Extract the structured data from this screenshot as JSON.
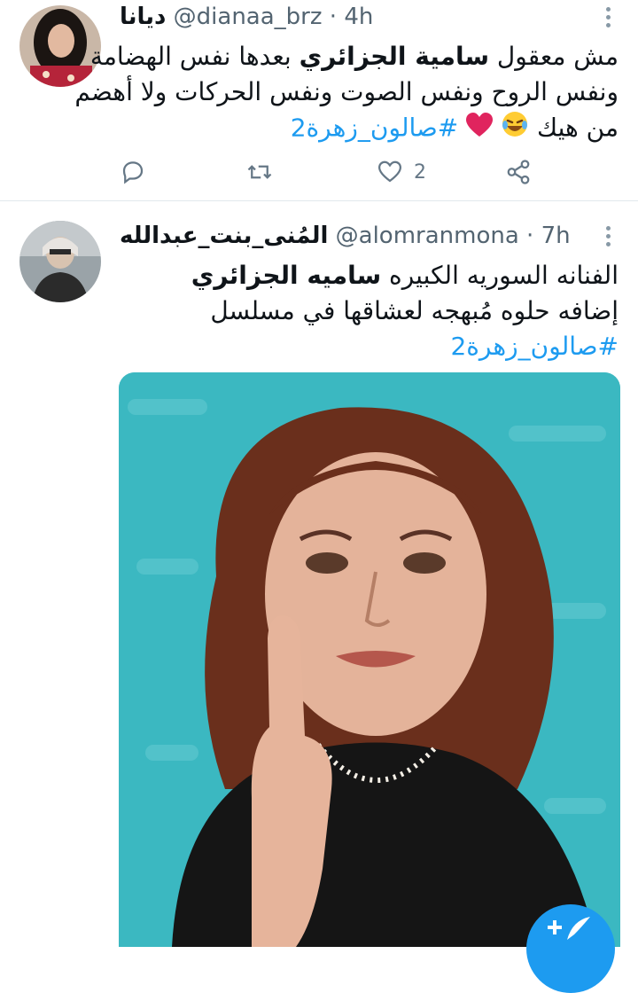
{
  "tweets": [
    {
      "display_name": "ديانا",
      "handle": "@dianaa_brz",
      "separator": "·",
      "time": "4h",
      "lines": [
        {
          "pre": "مش معقول ",
          "bold": "سامية الجزائري",
          "post": " بعدها نفس الهضامة"
        },
        {
          "text": "ونفس الروح ونفس الصوت ونفس الحركات ولا أهضم"
        },
        {
          "text": "من هيك",
          "emoji": [
            "laughing-crying",
            "red-heart"
          ],
          "hashtag": "#صالون_زهرة2"
        }
      ],
      "actions": {
        "reply_count": "",
        "retweet_count": "",
        "like_count": "2"
      }
    },
    {
      "display_name": "المُنى_بنت_عبدالله",
      "handle": "@alomranmona",
      "separator": "·",
      "time": "7h",
      "lines": [
        {
          "pre": "الفنانه السوريه الكبيره ",
          "bold": "ساميه الجزائري"
        },
        {
          "text": "إضافه حلوه مُبهجه لعشاقها في مسلسل"
        },
        {
          "hashtag": "#صالون_زهرة2"
        }
      ],
      "media": {
        "description_icon": "portrait-photo"
      }
    }
  ],
  "colors": {
    "accent": "#1d9bf0",
    "muted": "#536471",
    "divider": "#e1e8ed",
    "heart": "#e0245e",
    "media_bg": "#3bb8c1"
  },
  "fab": {
    "icon": "compose-tweet-icon",
    "label": "+"
  }
}
